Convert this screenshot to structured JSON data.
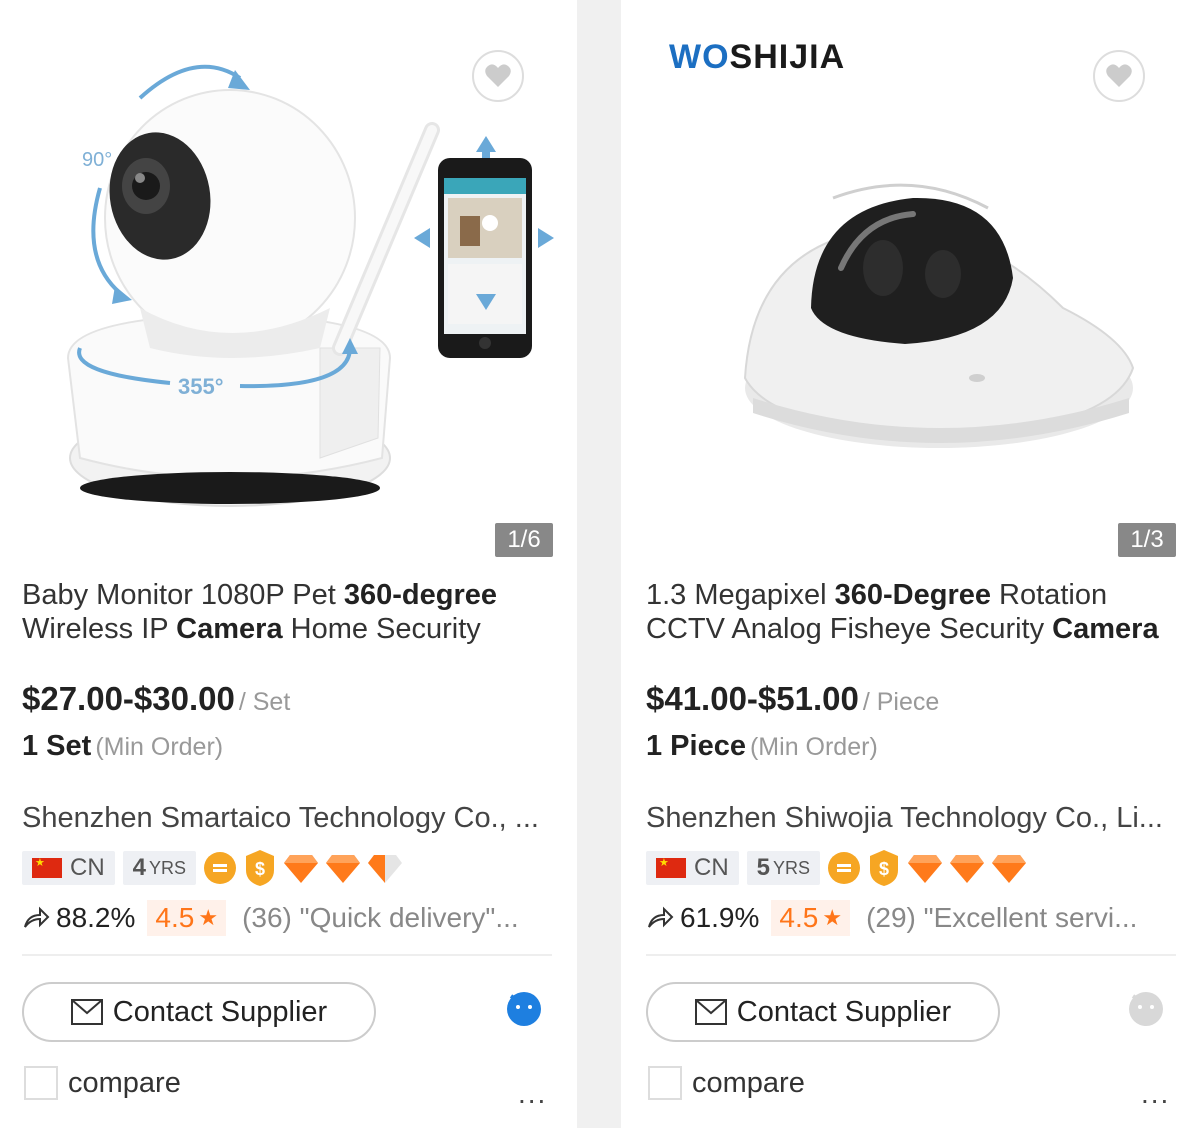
{
  "products": [
    {
      "title_parts": [
        {
          "text": "Baby Monitor 1080P Pet ",
          "bold": false
        },
        {
          "text": "360-degree",
          "bold": true
        },
        {
          "text": " Wireless IP ",
          "bold": false
        },
        {
          "text": "Camera",
          "bold": true
        },
        {
          "text": " Home Security",
          "bold": false
        }
      ],
      "image_counter": "1/6",
      "price": "$27.00-$30.00",
      "price_unit": "/ Set",
      "moq": "1 Set",
      "moq_label": "(Min Order)",
      "supplier": "Shenzhen Smartaico Technology Co., ...",
      "country": "CN",
      "years_num": "4",
      "years_unit": "YRS",
      "diamonds": 2.5,
      "response_rate": "88.2%",
      "rating": "4.5",
      "review_count": "(36)",
      "review_quote": "\"Quick delivery\"...",
      "contact_label": "Contact Supplier",
      "chat_status": "online",
      "compare_label": "compare",
      "more_label": "...",
      "image_labels": {
        "tilt": "90°",
        "pan": "355°"
      }
    },
    {
      "brand_logo": "WOSHIJIA",
      "title_parts": [
        {
          "text": "1.3 Megapixel ",
          "bold": false
        },
        {
          "text": "360-Degree",
          "bold": true
        },
        {
          "text": " Rotation CCTV Analog Fisheye Security ",
          "bold": false
        },
        {
          "text": "Camera",
          "bold": true
        }
      ],
      "image_counter": "1/3",
      "price": "$41.00-$51.00",
      "price_unit": "/ Piece",
      "moq": "1 Piece",
      "moq_label": "(Min Order)",
      "supplier": "Shenzhen Shiwojia Technology Co., Li...",
      "country": "CN",
      "years_num": "5",
      "years_unit": "YRS",
      "diamonds": 3,
      "response_rate": "61.9%",
      "rating": "4.5",
      "review_count": "(29)",
      "review_quote": "\"Excellent servi...",
      "contact_label": "Contact Supplier",
      "chat_status": "offline",
      "compare_label": "compare",
      "more_label": "..."
    }
  ],
  "colors": {
    "accent_orange": "#ff7519",
    "rating_bg": "#fff1ea",
    "chat_online": "#1e7fe0",
    "chat_offline": "#d8d8d8",
    "gem": "#ff7a1a",
    "gold_badge": "#f6a623"
  }
}
